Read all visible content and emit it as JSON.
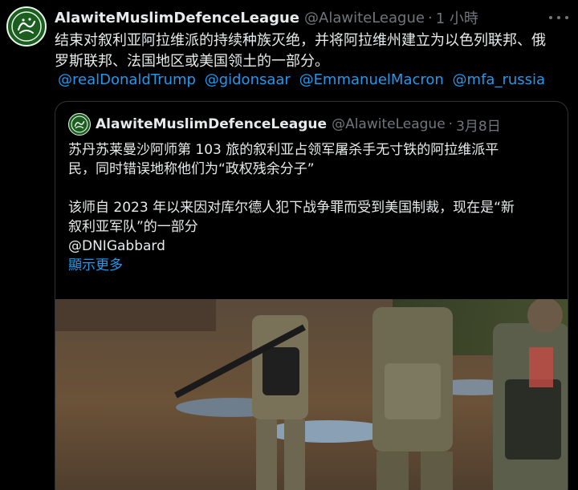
{
  "tweet": {
    "author_name": "AlawiteMuslimDefenceLeague",
    "handle": "@AlawiteLeague",
    "separator": "·",
    "time": "1 小時",
    "text_line1": "结束对叙利亚阿拉维派的持续种族灭绝，并将阿拉维州建立为以色列联邦、俄",
    "text_line2": "罗斯联邦、法国地区或美国领土的一部分。",
    "mentions": [
      "@realDonaldTrump",
      "@gidonsaar",
      "@EmmanuelMacron",
      "@mfa_russia"
    ],
    "avatar_icon": "calligraphy-emblem-icon",
    "more_icon": "more-options-icon"
  },
  "quote": {
    "author_name": "AlawiteMuslimDefenceLeague",
    "handle": "@AlawiteLeague",
    "separator": "·",
    "time": "3月8日",
    "para1_line1": "苏丹苏莱曼沙阿师第 103 旅的叙利亚占领军屠杀手无寸铁的阿拉维派平",
    "para1_line2": "民，同时错误地称他们为“政权残余分子”",
    "para2_line1": "该师自 2023 年以来因对库尔德人犯下战争罪而受到美国制裁，现在是“新",
    "para2_line2": "叙利亚军队”的一部分",
    "mention": "@DNIGabbard",
    "show_more": "顯示更多"
  },
  "colors": {
    "background": "#000000",
    "text": "#e7e9ea",
    "muted": "#71767b",
    "link": "#1d9bf0",
    "border": "#2f3336"
  }
}
